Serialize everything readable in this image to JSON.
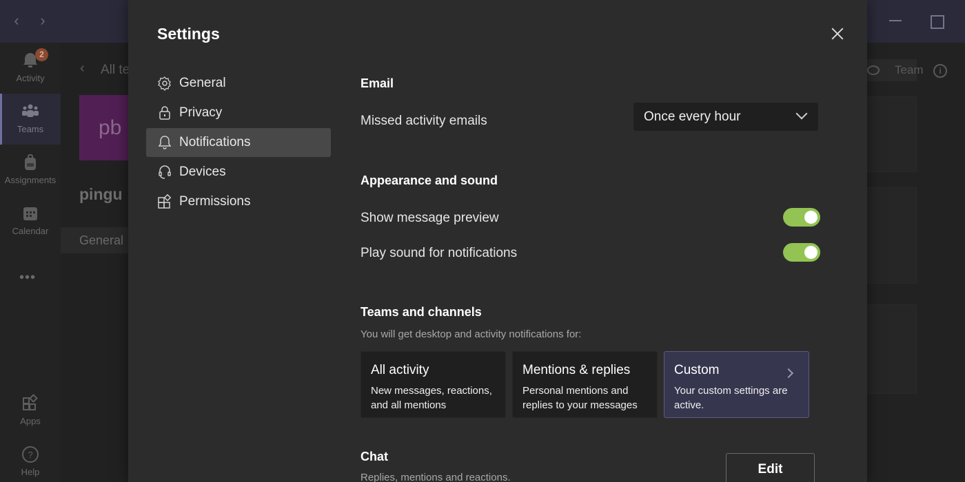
{
  "titlebar": {
    "back_glyph": "‹",
    "forward_glyph": "›"
  },
  "rail": {
    "items": [
      {
        "label": "Activity",
        "icon": "bell-icon",
        "badge": "2"
      },
      {
        "label": "Teams",
        "icon": "teams-icon",
        "active": true
      },
      {
        "label": "Assignments",
        "icon": "backpack-icon"
      },
      {
        "label": "Calendar",
        "icon": "calendar-icon"
      },
      {
        "label": "Apps",
        "icon": "apps-icon"
      },
      {
        "label": "Help",
        "icon": "help-icon"
      }
    ],
    "more_glyph": "•••"
  },
  "team_pane": {
    "back_glyph": "‹",
    "all_teams": "All te",
    "avatar_initials": "pb",
    "avatar_color": "#521f55",
    "team_name": "pingu",
    "channel": "General"
  },
  "right_area": {
    "team_chip": "Team",
    "info_glyph": "i"
  },
  "settings": {
    "title": "Settings",
    "nav": [
      {
        "label": "General",
        "icon": "gear-icon"
      },
      {
        "label": "Privacy",
        "icon": "lock-icon"
      },
      {
        "label": "Notifications",
        "icon": "bell-icon",
        "selected": true
      },
      {
        "label": "Devices",
        "icon": "headset-icon"
      },
      {
        "label": "Permissions",
        "icon": "permissions-icon"
      }
    ],
    "email": {
      "heading": "Email",
      "missed_label": "Missed activity emails",
      "missed_value": "Once every hour"
    },
    "appearance": {
      "heading": "Appearance and sound",
      "preview_label": "Show message preview",
      "preview_on": true,
      "sound_label": "Play sound for notifications",
      "sound_on": true
    },
    "teams_channels": {
      "heading": "Teams and channels",
      "subtext": "You will get desktop and activity notifications for:",
      "cards": [
        {
          "title": "All activity",
          "desc": "New messages, reactions, and all mentions"
        },
        {
          "title": "Mentions & replies",
          "desc": "Personal mentions and replies to your messages"
        },
        {
          "title": "Custom",
          "desc": "Your custom settings are active.",
          "selected": true
        }
      ]
    },
    "chat": {
      "heading": "Chat",
      "subtext": "Replies, mentions and reactions.",
      "edit_label": "Edit"
    }
  },
  "colors": {
    "toggle_on": "#92c353",
    "selected_card": "#37364f"
  }
}
